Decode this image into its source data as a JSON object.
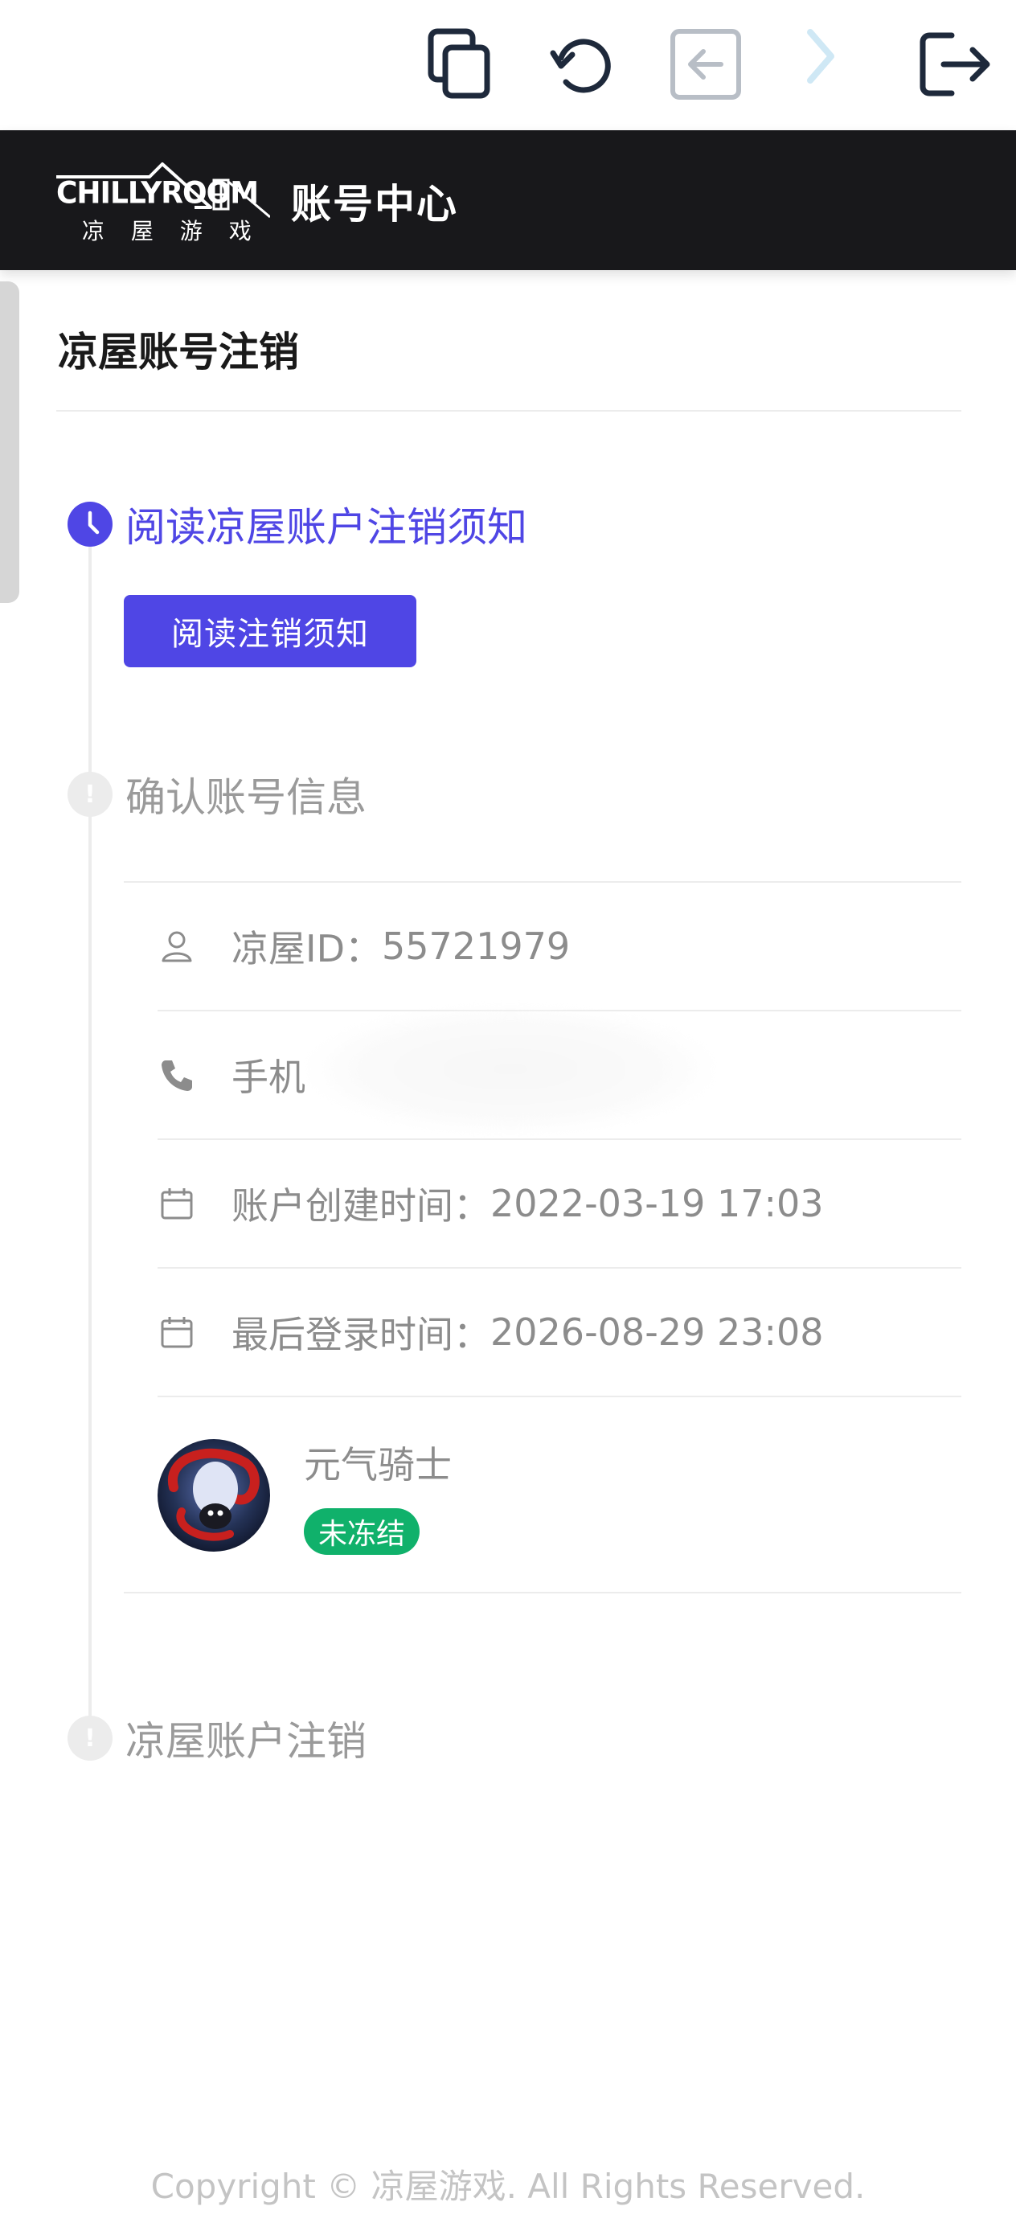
{
  "toolbar": {
    "icons": [
      "copy-icon",
      "refresh-icon",
      "back-icon",
      "forward-icon",
      "exit-icon"
    ]
  },
  "header": {
    "logo_text_en": "CHILLYROOM",
    "logo_text_cn": "凉 屋 游 戏",
    "title": "账号中心",
    "background": "#18181b"
  },
  "page": {
    "title": "凉屋账号注销"
  },
  "steps": [
    {
      "title": "阅读凉屋账户注销须知",
      "status": "active",
      "button_label": "阅读注销须知"
    },
    {
      "title": "确认账号信息",
      "status": "wait"
    },
    {
      "title": "凉屋账户注销",
      "status": "wait"
    }
  ],
  "account_info": {
    "id_label": "凉屋ID：",
    "id_value": "55721979",
    "phone_label": "手机",
    "created_label": "账户创建时间：",
    "created_value": "2022-03-19 17:03",
    "last_login_label": "最后登录时间：",
    "last_login_value": "2026-08-29 23:08"
  },
  "game": {
    "name": "元气骑士",
    "status": "未冻结",
    "status_color": "#10b16b"
  },
  "footer": {
    "copyright": "Copyright © 凉屋游戏. All Rights Reserved."
  },
  "colors": {
    "accent": "#4f46e5",
    "muted_text": "#8c8c8c",
    "divider": "#ececec"
  }
}
